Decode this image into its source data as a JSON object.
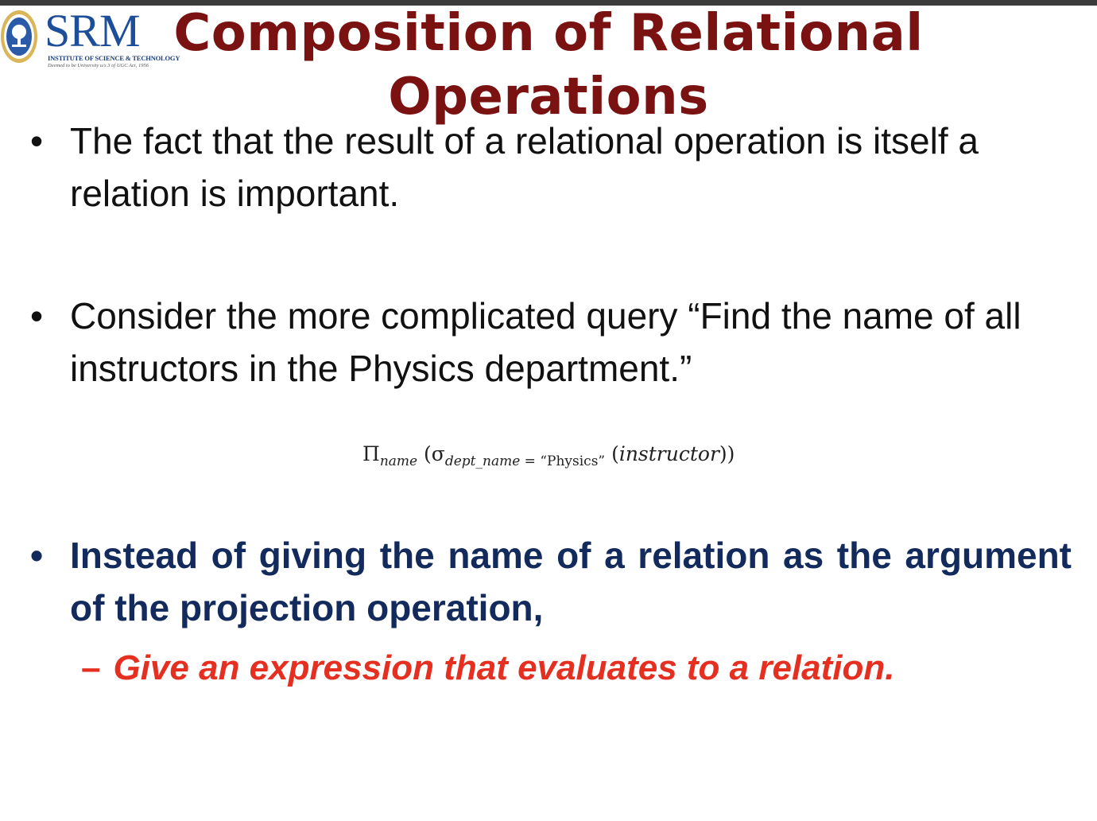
{
  "logo": {
    "wordmark": "SRM",
    "subtitle": "INSTITUTE OF SCIENCE & TECHNOLOGY",
    "tagline": "Deemed to be University u/s 3 of UGC Act, 1956"
  },
  "slide": {
    "title": "Composition of Relational Operations",
    "bullets": [
      {
        "text": "The fact that the result of a relational operation is itself a relation is important."
      },
      {
        "text": "Consider the more complicated query “Find the name of all instructors in the Physics department.”"
      },
      {
        "text": "Instead of giving the name of a relation as the argument of the projection operation,"
      }
    ],
    "sub_bullet": "Give an expression that evaluates to a relation.",
    "formula": {
      "pi": "Π",
      "pi_sub": "name",
      "sigma": "σ",
      "sigma_sub": "dept_name",
      "sigma_cond": " = “Physics”",
      "relation": "instructor"
    },
    "colors": {
      "title": "#7a1212",
      "emphasis_bullet": "#132a5c",
      "sub_bullet": "#e53021",
      "logo": "#1d4e9a"
    }
  }
}
